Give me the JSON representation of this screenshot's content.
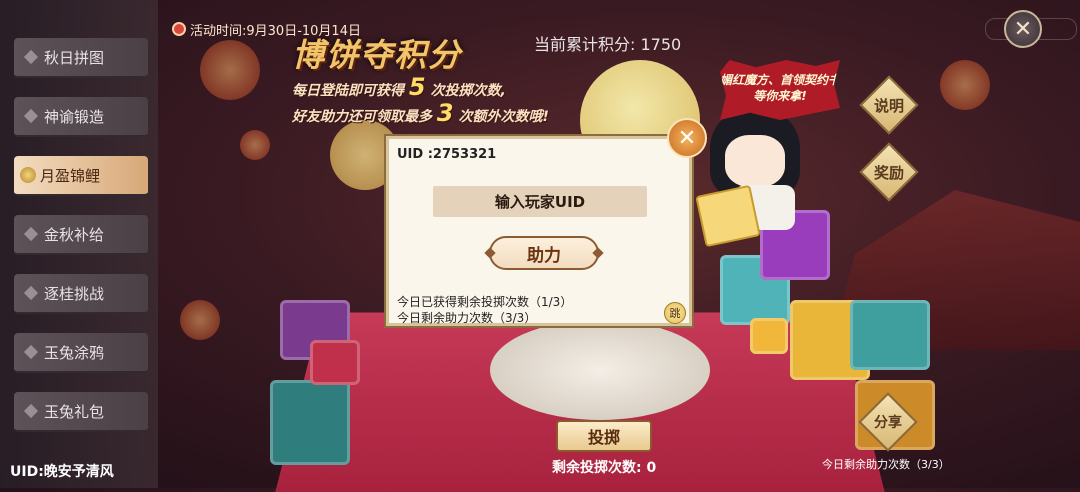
{
  "sidebar": {
    "items": [
      {
        "label": "秋日拼图",
        "active": false
      },
      {
        "label": "神谕锻造",
        "active": false
      },
      {
        "label": "月盈锦鲤",
        "active": true
      },
      {
        "label": "金秋补给",
        "active": false
      },
      {
        "label": "逐桂挑战",
        "active": false
      },
      {
        "label": "玉兔涂鸦",
        "active": false
      },
      {
        "label": "玉兔礼包",
        "active": false
      }
    ],
    "user_uid": "UID:晚安予清风"
  },
  "header": {
    "event_time": "活动时间:9月30日-10月14日",
    "title": "博饼夺积分",
    "desc_line1_a": "每日登陆即可获得",
    "desc_line1_num": "5",
    "desc_line1_b": "次投掷次数,",
    "desc_line2_a": "好友助力还可领取最多",
    "desc_line2_num": "3",
    "desc_line2_b": "次额外次数哦!",
    "score": "当前累计积分: 1750"
  },
  "promo": {
    "text": "媚红魔方、首领契约书等你来拿!"
  },
  "side_buttons": {
    "info": "说明",
    "reward": "奖励",
    "share": "分享"
  },
  "dialog": {
    "uid": "UID :2753321",
    "input_placeholder": "输入玩家UID",
    "help_button": "助力",
    "line1": "今日已获得剩余投掷次数（1/3）",
    "line2": "今日剩余助力次数（3/3）",
    "skip": "跳",
    "close_glyph": "✕"
  },
  "bottom": {
    "throw_button": "投掷",
    "remaining_throws": "剩余投掷次数: 0",
    "remaining_help": "今日剩余助力次数（3/3）"
  },
  "top_close_glyph": "✕",
  "icons": [
    "clock-icon",
    "close-icon",
    "skip-icon",
    "diamond-icon"
  ]
}
